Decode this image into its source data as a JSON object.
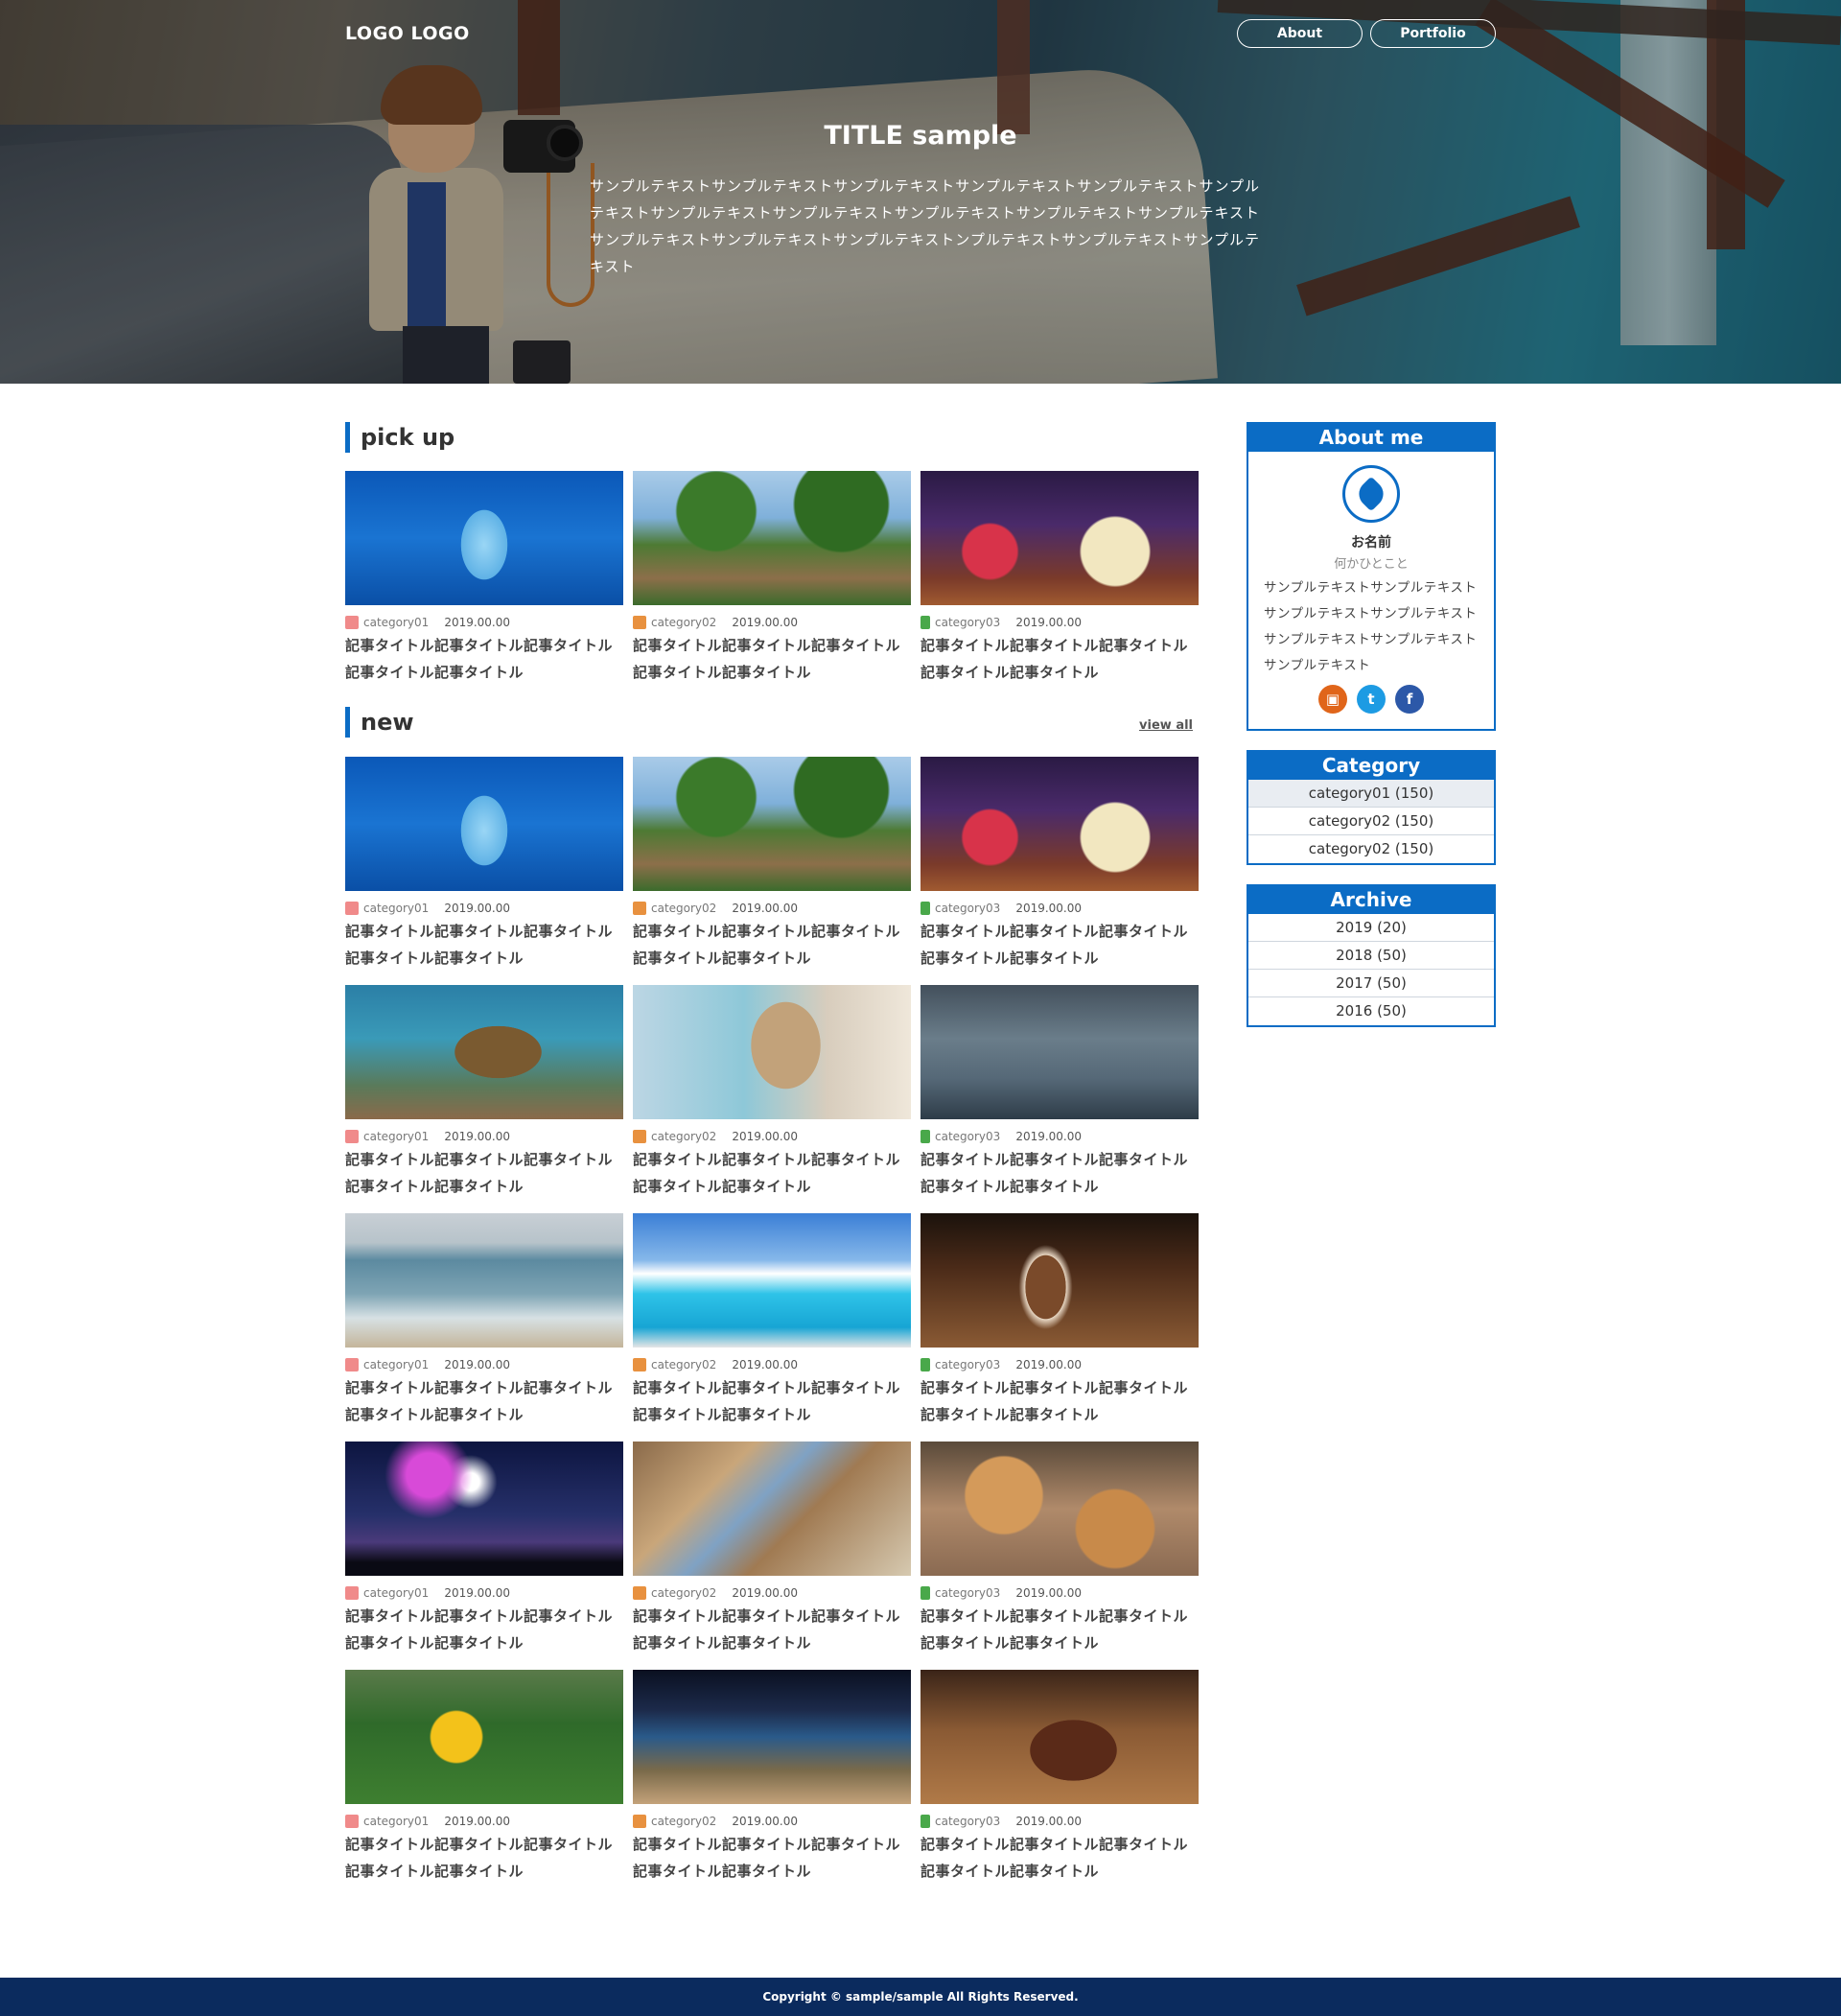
{
  "header": {
    "logo": "LOGO LOGO",
    "nav": [
      {
        "label": "About"
      },
      {
        "label": "Portfolio"
      }
    ],
    "title": "TITLE sample",
    "text": "サンプルテキストサンプルテキストサンプルテキストサンプルテキストサンプルテキストサンプルテキストサンプルテキストサンプルテキストサンプルテキストサンプルテキストサンプルテキストサンプルテキストサンプルテキストサンプルテキストンプルテキストサンプルテキストサンプルテキスト"
  },
  "pickup": {
    "heading": "pick up",
    "items": [
      {
        "category": "category01",
        "date": "2019.00.00",
        "title": "記事タイトル記事タイトル記事タイトル記事タイトル記事タイトル",
        "image": "dolphin"
      },
      {
        "category": "category02",
        "date": "2019.00.00",
        "title": "記事タイトル記事タイトル記事タイトル記事タイトル記事タイトル",
        "image": "palm-resort"
      },
      {
        "category": "category03",
        "date": "2019.00.00",
        "title": "記事タイトル記事タイトル記事タイトル記事タイトル記事タイトル",
        "image": "cocktails"
      }
    ]
  },
  "new": {
    "heading": "new",
    "view_all": "view all",
    "items": [
      {
        "category": "category01",
        "date": "2019.00.00",
        "title": "記事タイトル記事タイトル記事タイトル記事タイトル記事タイトル",
        "image": "dolphin"
      },
      {
        "category": "category02",
        "date": "2019.00.00",
        "title": "記事タイトル記事タイトル記事タイトル記事タイトル記事タイトル",
        "image": "palm-resort"
      },
      {
        "category": "category03",
        "date": "2019.00.00",
        "title": "記事タイトル記事タイトル記事タイトル記事タイトル記事タイトル",
        "image": "cocktails"
      },
      {
        "category": "category01",
        "date": "2019.00.00",
        "title": "記事タイトル記事タイトル記事タイトル記事タイトル記事タイトル",
        "image": "sea-turtle"
      },
      {
        "category": "category02",
        "date": "2019.00.00",
        "title": "記事タイトル記事タイトル記事タイトル記事タイトル記事タイトル",
        "image": "hanging-chair"
      },
      {
        "category": "category03",
        "date": "2019.00.00",
        "title": "記事タイトル記事タイトル記事タイトル記事タイトル記事タイトル",
        "image": "car-milkshake"
      },
      {
        "category": "category01",
        "date": "2019.00.00",
        "title": "記事タイトル記事タイトル記事タイトル記事タイトル記事タイトル",
        "image": "sea-dog"
      },
      {
        "category": "category02",
        "date": "2019.00.00",
        "title": "記事タイトル記事タイトル記事タイトル記事タイトル記事タイトル",
        "image": "pool"
      },
      {
        "category": "category03",
        "date": "2019.00.00",
        "title": "記事タイトル記事タイトル記事タイトル記事タイトル記事タイトル",
        "image": "ice-cream"
      },
      {
        "category": "category01",
        "date": "2019.00.00",
        "title": "記事タイトル記事タイトル記事タイトル記事タイトル記事タイトル",
        "image": "fireworks"
      },
      {
        "category": "category02",
        "date": "2019.00.00",
        "title": "記事タイトル記事タイトル記事タイトル記事タイトル記事タイトル",
        "image": "hotel-room"
      },
      {
        "category": "category03",
        "date": "2019.00.00",
        "title": "記事タイトル記事タイトル記事タイトル記事タイトル記事タイトル",
        "image": "donuts"
      },
      {
        "category": "category01",
        "date": "2019.00.00",
        "title": "記事タイトル記事タイトル記事タイトル記事タイトル記事タイトル",
        "image": "hibiscus"
      },
      {
        "category": "category02",
        "date": "2019.00.00",
        "title": "記事タイトル記事タイトル記事タイトル記事タイトル記事タイトル",
        "image": "night-lounge"
      },
      {
        "category": "category03",
        "date": "2019.00.00",
        "title": "記事タイトル記事タイトル記事タイトル記事タイトル記事タイトル",
        "image": "steak"
      }
    ]
  },
  "sidebar": {
    "about": {
      "heading": "About me",
      "name": "お名前",
      "tagline": "何かひとこと",
      "bio": "サンプルテキストサンプルテキストサンプルテキストサンプルテキストサンプルテキストサンプルテキストサンプルテキスト",
      "socials": [
        {
          "icon": "instagram-icon"
        },
        {
          "icon": "twitter-icon"
        },
        {
          "icon": "facebook-icon"
        }
      ]
    },
    "category": {
      "heading": "Category",
      "items": [
        {
          "label": "category01 (150)"
        },
        {
          "label": "category02 (150)"
        },
        {
          "label": "category02 (150)"
        }
      ]
    },
    "archive": {
      "heading": "Archive",
      "items": [
        {
          "label": "2019 (20)"
        },
        {
          "label": "2018 (50)"
        },
        {
          "label": "2017 (50)"
        },
        {
          "label": "2016 (50)"
        }
      ]
    }
  },
  "footer": {
    "copyright": "Copyright © sample/sample All Rights Reserved."
  },
  "colors": {
    "accent": "#0b6cc5",
    "footer_bg": "#0b2b5e",
    "category01": "#f08a8a",
    "category02": "#e8913f",
    "category03": "#49a84a"
  }
}
